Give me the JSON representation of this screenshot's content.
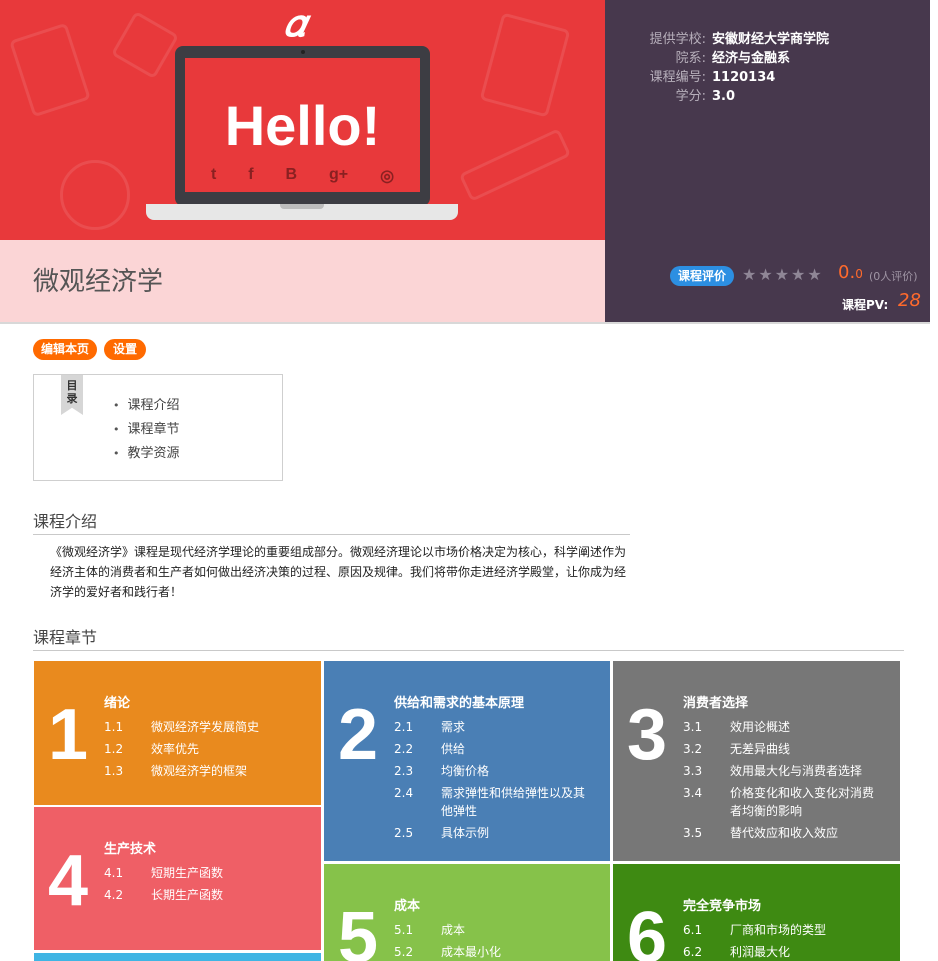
{
  "banner": {
    "logo": "𝛼",
    "screen_text": "Hello!",
    "social_icons": [
      "twitter-icon",
      "facebook-icon",
      "blogger-icon",
      "google-plus-icon",
      "github-icon"
    ]
  },
  "course": {
    "title": "微观经济学"
  },
  "info": [
    {
      "label": "提供学校:",
      "value": "安徽财经大学商学院"
    },
    {
      "label": "院系:",
      "value": "经济与金融系"
    },
    {
      "label": "课程编号:",
      "value": "1120134"
    },
    {
      "label": "学分:",
      "value": "3.0"
    }
  ],
  "rating": {
    "badge": "课程评价",
    "stars": "★★★★★",
    "score_int": "0.",
    "score_dec": "0",
    "raters": "(0人评价)",
    "pv_label": "课程PV:",
    "pv_value": "28"
  },
  "actions": {
    "edit": "编辑本页",
    "settings": "设置"
  },
  "toc": {
    "ribbon": "目\n录",
    "items": [
      "课程介绍",
      "课程章节",
      "教学资源"
    ]
  },
  "intro": {
    "heading": "课程介绍",
    "text": "《微观经济学》课程是现代经济学理论的重要组成部分。微观经济理论以市场价格决定为核心，科学阐述作为经济主体的消费者和生产者如何做出经济决策的过程、原因及规律。我们将带你走进经济学殿堂，让你成为经济学的爱好者和践行者！"
  },
  "chapters_heading": "课程章节",
  "chapters": [
    {
      "num": "1",
      "title": "绪论",
      "color": "#e98a1e",
      "items": [
        [
          "1.1",
          "微观经济学发展简史"
        ],
        [
          "1.2",
          "效率优先"
        ],
        [
          "1.3",
          "微观经济学的框架"
        ]
      ]
    },
    {
      "num": "2",
      "title": "供给和需求的基本原理",
      "color": "#4a7fb5",
      "items": [
        [
          "2.1",
          "需求"
        ],
        [
          "2.2",
          "供给"
        ],
        [
          "2.3",
          "均衡价格"
        ],
        [
          "2.4",
          "需求弹性和供给弹性以及其他弹性"
        ],
        [
          "2.5",
          "具体示例"
        ]
      ]
    },
    {
      "num": "3",
      "title": "消费者选择",
      "color": "#777777",
      "items": [
        [
          "3.1",
          "效用论概述"
        ],
        [
          "3.2",
          "无差异曲线"
        ],
        [
          "3.3",
          "效用最大化与消费者选择"
        ],
        [
          "3.4",
          "价格变化和收入变化对消费者均衡的影响"
        ],
        [
          "3.5",
          "替代效应和收入效应"
        ]
      ]
    },
    {
      "num": "4",
      "title": "生产技术",
      "color": "#ef5f66",
      "items": [
        [
          "4.1",
          "短期生产函数"
        ],
        [
          "4.2",
          "长期生产函数"
        ]
      ]
    },
    {
      "num": "5",
      "title": "成本",
      "color": "#86c24a",
      "items": [
        [
          "5.1",
          "成本"
        ],
        [
          "5.2",
          "成本最小化"
        ]
      ]
    },
    {
      "num": "6",
      "title": "完全竞争市场",
      "color": "#3e8a12",
      "items": [
        [
          "6.1",
          "厂商和市场的类型"
        ],
        [
          "6.2",
          "利润最大化"
        ]
      ]
    },
    {
      "color": "#3fb5e4"
    }
  ]
}
